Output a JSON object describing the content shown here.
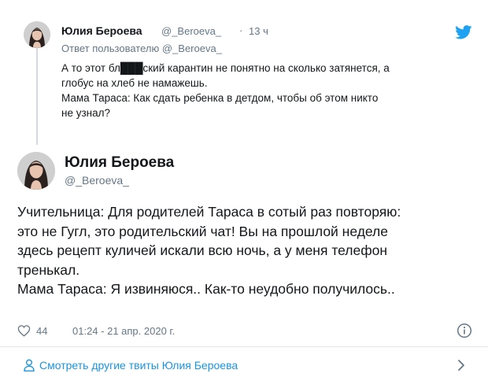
{
  "reply_tweet": {
    "author_name": "Юлия Бероева",
    "author_handle": "@_Beroeva_",
    "separator": "·",
    "time": "13 ч",
    "reply_to_prefix": "Ответ пользователю",
    "reply_to_handle": "@_Beroeva_",
    "text_lines": [
      "А то этот бл███ский карантин не понятно на сколько затянется, а",
      "глобус на хлеб не намажешь.",
      "Мама Тараса: Как сдать ребенка в детдом, чтобы об этом никто",
      "не узнал?"
    ]
  },
  "main_tweet": {
    "author_name": "Юлия Бероева",
    "author_handle": "@_Beroeva_",
    "text_lines": [
      "Учительница: Для родителей Тараса в сотый раз повторяю:",
      "это не Гугл, это родительский чат! Вы на прошлой неделе",
      "здесь рецепт куличей искали всю ночь, а у меня телефон",
      "тренькал.",
      "Мама Тараса: Я извиняюся.. Как-то неудобно получилось.."
    ],
    "like_count": "44",
    "timestamp": "01:24 - 21 апр. 2020 г."
  },
  "footer": {
    "more_tweets_label": "Смотреть другие твиты Юлия Бероева"
  },
  "icons": {
    "brand": "twitter-bird-icon",
    "like": "heart-icon",
    "info": "info-icon",
    "profile": "person-icon",
    "navigate": "chevron-right-icon"
  },
  "colors": {
    "text_primary": "#14171a",
    "text_secondary": "#657786",
    "link_blue": "#1b95e0",
    "twitter_blue": "#1da1f2",
    "thread_line": "#d4dadf"
  }
}
